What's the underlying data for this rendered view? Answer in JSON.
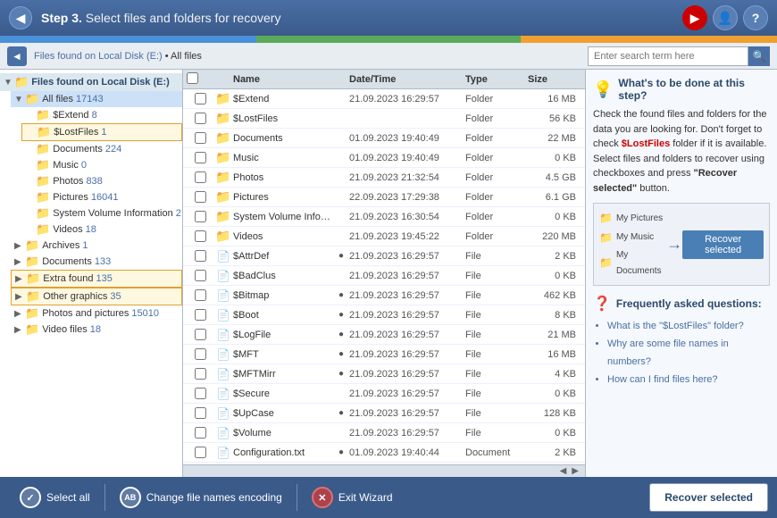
{
  "titleBar": {
    "backLabel": "←",
    "step": "Step 3.",
    "title": " Select files and folders for recovery"
  },
  "breadcrumb": {
    "backLabel": "◄",
    "path": "Files found on Local Disk (E:)",
    "separator": " • ",
    "current": "All files",
    "searchPlaceholder": "Enter search term here"
  },
  "tree": {
    "rootLabel": "Files found on Local Disk (E:)",
    "items": [
      {
        "label": "All files",
        "count": "17143",
        "indent": 0,
        "selected": true
      },
      {
        "label": "$Extend",
        "count": "8",
        "indent": 1
      },
      {
        "label": "$LostFiles",
        "count": "1",
        "indent": 1,
        "highlighted": true
      },
      {
        "label": "Documents",
        "count": "224",
        "indent": 1
      },
      {
        "label": "Music",
        "count": "0",
        "indent": 1
      },
      {
        "label": "Photos",
        "count": "838",
        "indent": 1
      },
      {
        "label": "Pictures",
        "count": "16041",
        "indent": 1
      },
      {
        "label": "System Volume Information",
        "count": "2",
        "indent": 1
      },
      {
        "label": "Videos",
        "count": "18",
        "indent": 1
      },
      {
        "label": "Archives",
        "count": "1",
        "indent": 0
      },
      {
        "label": "Documents",
        "count": "133",
        "indent": 0
      },
      {
        "label": "Extra found",
        "count": "135",
        "indent": 0,
        "highlighted": true
      },
      {
        "label": "Other graphics",
        "count": "35",
        "indent": 0,
        "highlighted": true
      },
      {
        "label": "Photos and pictures",
        "count": "15010",
        "indent": 0
      },
      {
        "label": "Video files",
        "count": "18",
        "indent": 0
      }
    ]
  },
  "fileListHeader": {
    "name": "Name",
    "date": "Date/Time",
    "type": "Type",
    "size": "Size"
  },
  "files": [
    {
      "name": "$Extend",
      "date": "21.09.2023 16:29:57",
      "type": "Folder",
      "size": "16 MB",
      "isFolder": true,
      "dot": false
    },
    {
      "name": "$LostFiles",
      "date": "",
      "type": "Folder",
      "size": "56 KB",
      "isFolder": true,
      "dot": false
    },
    {
      "name": "Documents",
      "date": "01.09.2023 19:40:49",
      "type": "Folder",
      "size": "22 MB",
      "isFolder": true,
      "dot": false
    },
    {
      "name": "Music",
      "date": "01.09.2023 19:40:49",
      "type": "Folder",
      "size": "0 KB",
      "isFolder": true,
      "dot": false
    },
    {
      "name": "Photos",
      "date": "21.09.2023 21:32:54",
      "type": "Folder",
      "size": "4.5 GB",
      "isFolder": true,
      "dot": false
    },
    {
      "name": "Pictures",
      "date": "22.09.2023 17:29:38",
      "type": "Folder",
      "size": "6.1 GB",
      "isFolder": true,
      "dot": false
    },
    {
      "name": "System Volume Info…",
      "date": "21.09.2023 16:30:54",
      "type": "Folder",
      "size": "0 KB",
      "isFolder": true,
      "dot": false
    },
    {
      "name": "Videos",
      "date": "21.09.2023 19:45:22",
      "type": "Folder",
      "size": "220 MB",
      "isFolder": true,
      "dot": false
    },
    {
      "name": "$AttrDef",
      "date": "21.09.2023 16:29:57",
      "type": "File",
      "size": "2 KB",
      "isFolder": false,
      "dot": true
    },
    {
      "name": "$BadClus",
      "date": "21.09.2023 16:29:57",
      "type": "File",
      "size": "0 KB",
      "isFolder": false,
      "dot": false
    },
    {
      "name": "$Bitmap",
      "date": "21.09.2023 16:29:57",
      "type": "File",
      "size": "462 KB",
      "isFolder": false,
      "dot": true
    },
    {
      "name": "$Boot",
      "date": "21.09.2023 16:29:57",
      "type": "File",
      "size": "8 KB",
      "isFolder": false,
      "dot": true
    },
    {
      "name": "$LogFile",
      "date": "21.09.2023 16:29:57",
      "type": "File",
      "size": "21 MB",
      "isFolder": false,
      "dot": true
    },
    {
      "name": "$MFT",
      "date": "21.09.2023 16:29:57",
      "type": "File",
      "size": "16 MB",
      "isFolder": false,
      "dot": true
    },
    {
      "name": "$MFTMirr",
      "date": "21.09.2023 16:29:57",
      "type": "File",
      "size": "4 KB",
      "isFolder": false,
      "dot": true
    },
    {
      "name": "$Secure",
      "date": "21.09.2023 16:29:57",
      "type": "File",
      "size": "0 KB",
      "isFolder": false,
      "dot": false
    },
    {
      "name": "$UpCase",
      "date": "21.09.2023 16:29:57",
      "type": "File",
      "size": "128 KB",
      "isFolder": false,
      "dot": true
    },
    {
      "name": "$Volume",
      "date": "21.09.2023 16:29:57",
      "type": "File",
      "size": "0 KB",
      "isFolder": false,
      "dot": false
    },
    {
      "name": "Configuration.txt",
      "date": "01.09.2023 19:40:44",
      "type": "Document",
      "size": "2 KB",
      "isFolder": false,
      "isDoc": true,
      "dot": true
    }
  ],
  "rightPanel": {
    "infoTitle": "What's to be done at this step?",
    "infoText": "Check the found files and folders for the data you are looking for. Don't forget to check",
    "highlightText": "$LostFiles",
    "infoText2": "folder if it is available. Select files and folders to recover using checkboxes and press",
    "boldText": "\"Recover selected\"",
    "infoText3": "button.",
    "diagram": {
      "items": [
        "My Pictures",
        "My Music",
        "My Documents"
      ],
      "arrowLabel": "→",
      "buttonLabel": "Recover selected"
    },
    "faqTitle": "Frequently asked questions:",
    "faqItems": [
      "What is the \"$LostFiles\" folder?",
      "Why are some file names in numbers?",
      "How can I find files here?"
    ]
  },
  "bottomBar": {
    "selectAllLabel": "Select all",
    "encodingLabel": "Change file names encoding",
    "exitLabel": "Exit Wizard",
    "recoverLabel": "Recover selected"
  }
}
